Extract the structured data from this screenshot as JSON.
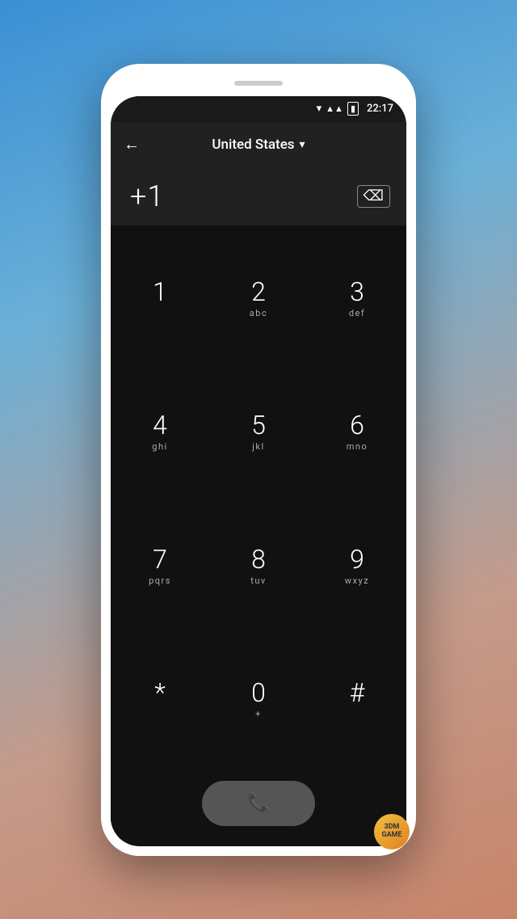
{
  "status_bar": {
    "time": "22:17"
  },
  "top_bar": {
    "back_label": "←",
    "country": "United States",
    "dropdown_icon": "▾"
  },
  "number_display": {
    "phone_number": "+1",
    "backspace_label": "⌫"
  },
  "dialpad": {
    "keys": [
      {
        "number": "1",
        "letters": ""
      },
      {
        "number": "2",
        "letters": "abc"
      },
      {
        "number": "3",
        "letters": "def"
      },
      {
        "number": "4",
        "letters": "ghi"
      },
      {
        "number": "5",
        "letters": "jkl"
      },
      {
        "number": "6",
        "letters": "mno"
      },
      {
        "number": "7",
        "letters": "pqrs"
      },
      {
        "number": "8",
        "letters": "tuv"
      },
      {
        "number": "9",
        "letters": "wxyz"
      },
      {
        "number": "*",
        "letters": ""
      },
      {
        "number": "0",
        "letters": "+"
      },
      {
        "number": "#",
        "letters": ""
      }
    ]
  },
  "call_button": {
    "icon": "📞"
  },
  "watermark": {
    "text": "3DM\nGAME"
  }
}
